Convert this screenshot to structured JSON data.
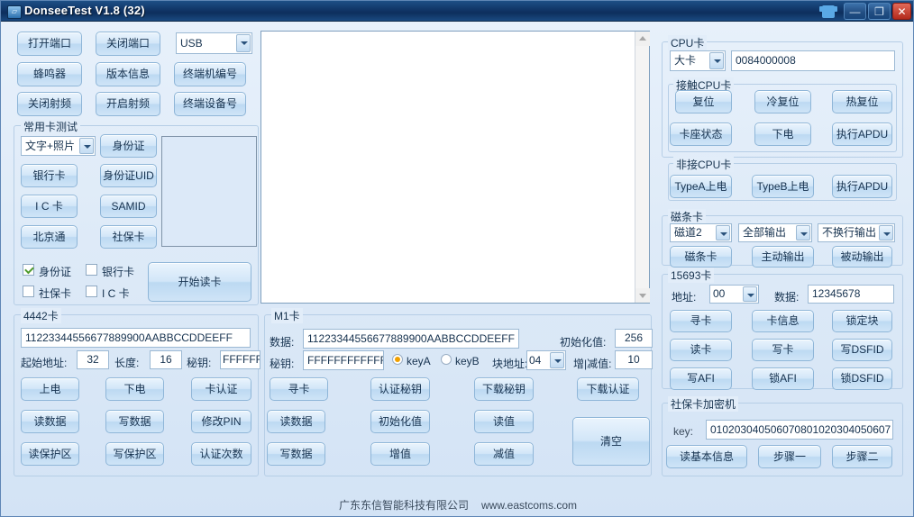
{
  "window": {
    "title": "DonseeTest V1.8  (32)",
    "icon": "app-icon",
    "buttons": {
      "shirt": "",
      "minimize": "—",
      "maximize": "❐",
      "close": "✕"
    }
  },
  "toolbar": {
    "open_port": "打开端口",
    "close_port": "关闭端口",
    "port_select": "USB",
    "buzzer": "蜂鸣器",
    "version_info": "版本信息",
    "terminal_no": "终端机编号",
    "close_rf": "关闭射频",
    "open_rf": "开启射频",
    "terminal_device_no": "终端设备号"
  },
  "common_card": {
    "title": "常用卡测试",
    "mode_select": "文字+照片",
    "id_card": "身份证",
    "bank_card": "银行卡",
    "id_card_uid": "身份证UID",
    "ic_card": "I C 卡",
    "samid": "SAMID",
    "beijing_tong": "北京通",
    "social_card": "社保卡",
    "checkboxes": [
      {
        "label": "身份证",
        "checked": true
      },
      {
        "label": "银行卡",
        "checked": false
      },
      {
        "label": "社保卡",
        "checked": false
      },
      {
        "label": "I C 卡",
        "checked": false
      }
    ],
    "start_read": "开始读卡"
  },
  "card4442": {
    "title": "4442卡",
    "data_value": "11223344556677889900AABBCCDDEEFF",
    "start_addr_label": "起始地址:",
    "start_addr_value": "32",
    "length_label": "长度:",
    "length_value": "16",
    "key_label": "秘钥:",
    "key_value": "FFFFFF",
    "buttons": [
      "上电",
      "下电",
      "卡认证",
      "读数据",
      "写数据",
      "修改PIN",
      "读保护区",
      "写保护区",
      "认证次数"
    ]
  },
  "m1card": {
    "title": "M1卡",
    "data_label": "数据:",
    "data_value": "11223344556677889900AABBCCDDEEFF",
    "init_label": "初始化值:",
    "init_value": "256",
    "key_label": "秘钥:",
    "key_value": "FFFFFFFFFFFF",
    "keyA": "keyA",
    "keyB": "keyB",
    "key_selected": "keyA",
    "block_addr_label": "块地址:",
    "block_addr_value": "04",
    "incdec_label": "增|减值:",
    "incdec_value": "10",
    "buttons": [
      "寻卡",
      "认证秘钥",
      "下载秘钥",
      "下载认证",
      "读数据",
      "初始化值",
      "读值",
      "写数据",
      "增值",
      "减值"
    ],
    "clear": "清空"
  },
  "cpu": {
    "title": "CPU卡",
    "card_type": "大卡",
    "apdu_value": "0084000008",
    "contact": {
      "title": "接触CPU卡",
      "buttons": [
        "复位",
        "冷复位",
        "热复位",
        "卡座状态",
        "下电",
        "执行APDU"
      ]
    },
    "contactless": {
      "title": "非接CPU卡",
      "buttons": [
        "TypeA上电",
        "TypeB上电",
        "执行APDU"
      ]
    }
  },
  "magnetic": {
    "title": "磁条卡",
    "track_select": "磁道2",
    "output_select": "全部输出",
    "newline_select": "不换行输出",
    "buttons": [
      "磁条卡",
      "主动输出",
      "被动输出"
    ]
  },
  "card15693": {
    "title": "15693卡",
    "addr_label": "地址:",
    "addr_value": "00",
    "data_label": "数据:",
    "data_value": "12345678",
    "buttons": [
      "寻卡",
      "卡信息",
      "锁定块",
      "读卡",
      "写卡",
      "写DSFID",
      "写AFI",
      "锁AFI",
      "锁DSFID"
    ]
  },
  "social_encryptor": {
    "title": "社保卡加密机",
    "key_label": "key:",
    "key_value": "010203040506070801020304050607",
    "buttons": [
      "读基本信息",
      "步骤一",
      "步骤二"
    ]
  },
  "footer": {
    "company": "广东东信智能科技有限公司",
    "url": "www.eastcoms.com"
  }
}
